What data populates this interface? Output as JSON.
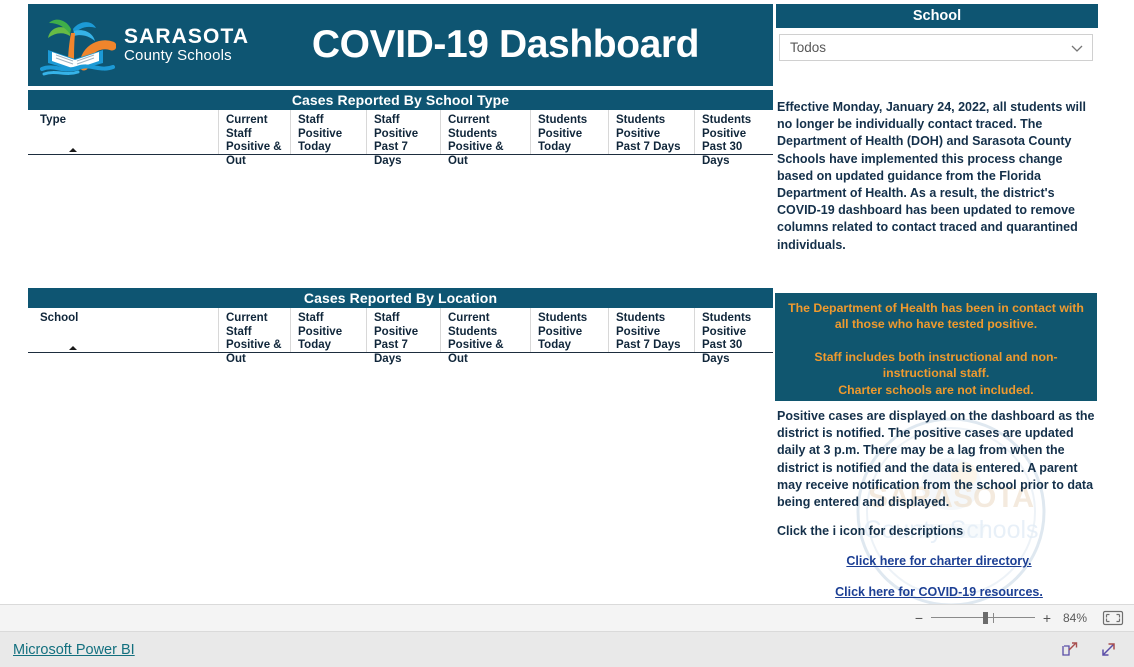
{
  "header": {
    "logo_line1": "SARASOTA",
    "logo_line2": "County Schools",
    "title": "COVID-19 Dashboard",
    "logo_icon": "palm-tree-book-logo",
    "brand_teal": "#0e5572",
    "brand_orange": "#ef9a2e",
    "brand_green": "#67bb45",
    "brand_blue": "#1c9ad6"
  },
  "tables": [
    {
      "id": "school-type",
      "title": "Cases Reported By School Type",
      "sort_indicator": "ascending-sort-triangle",
      "columns": [
        "Type",
        "Current Staff Positive & Out",
        "Staff Positive Today",
        "Staff Positive Past 7 Days",
        "Current Students Positive & Out",
        "Students Positive Today",
        "Students Positive Past 7 Days",
        "Students Positive Past 30 Days"
      ],
      "rows": []
    },
    {
      "id": "location",
      "title": "Cases Reported By Location",
      "sort_indicator": "ascending-sort-triangle",
      "columns": [
        "School",
        "Current Staff Positive & Out",
        "Staff Positive Today",
        "Staff Positive Past 7 Days",
        "Current Students Positive & Out",
        "Students Positive Today",
        "Students Positive Past 7 Days",
        "Students Positive Past 30 Days"
      ],
      "rows": []
    }
  ],
  "slicer": {
    "title": "School",
    "value": "Todos",
    "chevron_icon": "chevron-down-icon"
  },
  "rail": {
    "notice": "Effective Monday, January 24, 2022, all students will no longer be individually contact traced. The Department of Health (DOH) and Sarasota County Schools have implemented this process change based on updated guidance from the Florida Department of Health. As a result, the district's COVID-19 dashboard has been updated to remove columns related to contact traced and quarantined individuals.",
    "highlight_1": "The Department of Health has been in contact with all those who have tested positive.",
    "highlight_2": "Staff includes both instructional and non-instructional staff.",
    "highlight_3": "Charter schools are not included.",
    "positive_note": "Positive cases are displayed on the dashboard as the district is notified. The positive cases are updated daily at 3 p.m. There may be a lag from when the district is notified and the data is entered. A parent may receive notification from the school prior to data being entered and displayed.",
    "icon_note": "Click the i icon for descriptions",
    "link_charter": "Click here for charter directory.",
    "link_resources": "Click here for COVID-19 resources.",
    "watermark_line1": "SARASOTA",
    "watermark_line2": "County Schools"
  },
  "statusbar": {
    "zoom_out_label": "−",
    "zoom_in_label": "+",
    "zoom_level": "84%",
    "fit_icon": "fit-to-screen-icon"
  },
  "footer": {
    "powerbi_label": "Microsoft Power BI",
    "share_icon": "share-icon",
    "fullscreen_icon": "fullscreen-expand-icon"
  }
}
